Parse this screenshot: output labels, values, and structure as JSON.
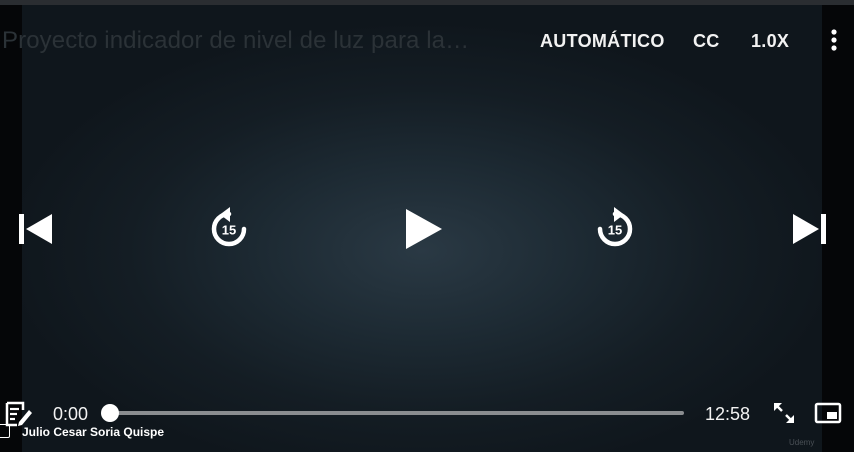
{
  "video": {
    "title": "Proyecto indicador de nivel de luz para la…",
    "author": "Julio Cesar Soria Quispe",
    "watermark": "Udemy"
  },
  "top_controls": {
    "quality_label": "AUTOMÁTICO",
    "captions_label": "CC",
    "speed_label": "1.0X",
    "more_icon": "vertical-ellipsis-icon"
  },
  "center_controls": {
    "previous_icon": "skip-previous-icon",
    "rewind_icon": "rewind-15-icon",
    "rewind_seconds": "15",
    "play_icon": "play-icon",
    "forward_icon": "forward-15-icon",
    "forward_seconds": "15",
    "next_icon": "skip-next-icon"
  },
  "bottom_bar": {
    "notes_icon": "notes-icon",
    "current_time": "0:00",
    "total_time": "12:58",
    "progress_fraction": 0.0,
    "fullscreen_icon": "expand-icon",
    "pip_icon": "picture-in-picture-icon"
  },
  "colors": {
    "background": "#050608",
    "video_center": "#2a3944",
    "video_edge": "#0f161c",
    "control_white": "#ffffff",
    "track_gray": "#8a8d90"
  }
}
